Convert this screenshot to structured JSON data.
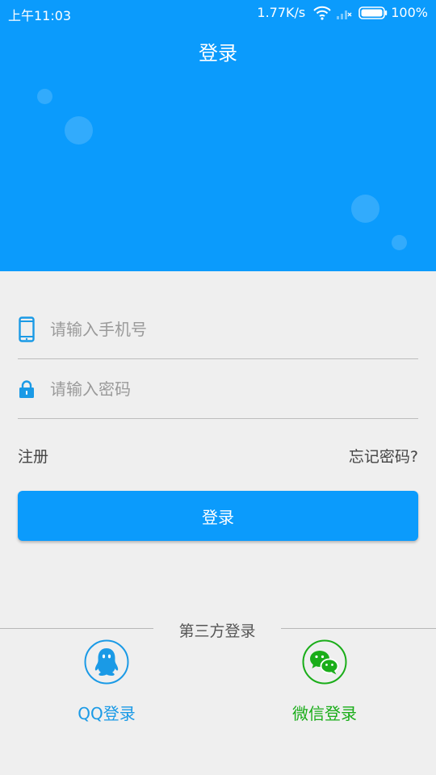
{
  "status_bar": {
    "time": "上午11:03",
    "net_speed": "1.77K/s",
    "battery": "100%"
  },
  "header": {
    "title": "登录",
    "background_color": "#0b9bfc"
  },
  "form": {
    "phone": {
      "placeholder": "请输入手机号",
      "value": "",
      "icon": "phone-icon"
    },
    "password": {
      "placeholder": "请输入密码",
      "value": "",
      "icon": "lock-icon"
    },
    "register_label": "注册",
    "forgot_label": "忘记密码?",
    "login_label": "登录"
  },
  "third_party": {
    "title": "第三方登录",
    "qq": {
      "label": "QQ登录",
      "icon": "qq-penguin-icon",
      "color": "#1a9ae6"
    },
    "wechat": {
      "label": "微信登录",
      "icon": "wechat-icon",
      "color": "#1aad19"
    }
  }
}
